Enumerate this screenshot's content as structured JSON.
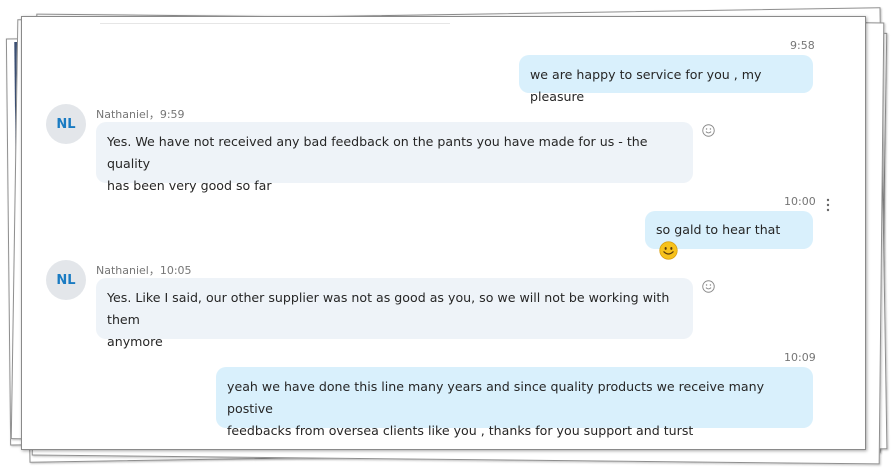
{
  "conversation": {
    "top_message": {
      "time": "9:58",
      "text": "we are happy to service for you , my pleasure"
    },
    "msg_nathaniel_1": {
      "avatar": "NL",
      "sender_line": "Nathaniel，9:59",
      "line1": "Yes. We have not received any bad feedback on the pants you have made for us - the quality",
      "line2": "has been very good so far"
    },
    "msg_me_1": {
      "time": "10:00",
      "text": "so gald to hear that",
      "emoji": "smiley-face-emoji"
    },
    "msg_nathaniel_2": {
      "avatar": "NL",
      "sender_line": "Nathaniel，10:05",
      "line1": "Yes. Like I said, our other supplier was not as good as you, so we will not be working with them",
      "line2": "anymore"
    },
    "msg_me_2": {
      "time": "10:09",
      "line1": "yeah we have done this line many years and since quality products we receive many postive",
      "line2": "feedbacks from oversea clients like you , thanks for you support and turst"
    }
  },
  "icons": {
    "reaction": "smiley-outline-icon",
    "more_options": "vertical-ellipsis-icon"
  },
  "colors": {
    "outgoing_bubble": "#d9f0fc",
    "incoming_bubble": "#eef3f8",
    "avatar_text": "#1a7bc2",
    "avatar_bg": "#e3e6ea"
  }
}
